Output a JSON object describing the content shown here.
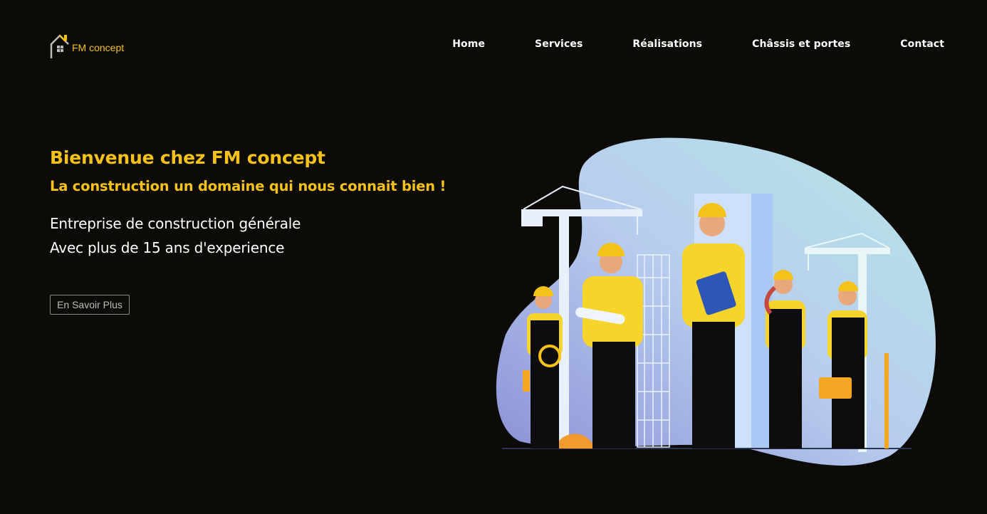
{
  "brand": {
    "name_prefix": "FM",
    "name_suffix": " concept",
    "logo_icon": "house-icon",
    "accent": "#f5c21a",
    "background": "#0d0b08"
  },
  "nav": {
    "items": [
      {
        "label": "Home"
      },
      {
        "label": "Services"
      },
      {
        "label": "Réalisations"
      },
      {
        "label": "Châssis et portes"
      },
      {
        "label": "Contact"
      }
    ]
  },
  "hero": {
    "title": "Bienvenue chez FM concept",
    "subtitle": "La construction un domaine qui nous connait bien !",
    "line1": "Entreprise de construction générale",
    "line2": "Avec plus de 15 ans d'experience",
    "cta_label": "En Savoir Plus"
  },
  "illustration": {
    "icon": "construction-workers-illustration"
  }
}
